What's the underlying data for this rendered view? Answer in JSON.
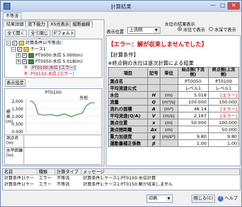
{
  "window": {
    "title": "計算結果"
  },
  "left": {
    "outer_tab": "不等流",
    "tabs": [
      "結果詳細",
      "流下能力",
      "XS光表示",
      "縦断曲線"
    ],
    "buttons": [
      "全て開く",
      "全て閉じる",
      "デフォルト"
    ],
    "tree": [
      {
        "label": "計算条件1(不等流)",
        "level": 0
      },
      {
        "label": "ケース1",
        "level": 1
      },
      {
        "label": "PT0000:水位 5.000(m)",
        "level": 2,
        "error": false
      },
      {
        "label": "PT0050:水位 5.018(m)",
        "level": 2,
        "error": false
      },
      {
        "label": "PT0100:水位 [エラー]",
        "level": 2,
        "error": true,
        "selected": true
      },
      {
        "label": "PT0150:水位 [エラー]",
        "level": 2,
        "error": true
      }
    ],
    "display_settings_button": "表示設定",
    "plot": {
      "title": "PT0100",
      "outside_label": "外形",
      "y_label": "標高(m)",
      "y_ticks": [
        "2,000",
        "1,500",
        "1,000",
        "0.500",
        "0.000"
      ],
      "rows": [
        {
          "label": "測点名",
          "sub": "(m)"
        },
        {
          "label": "水平距離",
          "sub": "(m)"
        }
      ]
    }
  },
  "right": {
    "display_position_label": "表示位置",
    "display_position_value": "上流側",
    "water_level_label": "水位の結果表示",
    "radio_options": [
      "水位で表示",
      "水深で表示"
    ],
    "radio_selected": 0,
    "error_message": "【エラー：解が収束しませんでした】",
    "section_title": "【計算条件】",
    "note": "※終点側の水位は逐次計算による結果",
    "table": {
      "headers": [
        "項目",
        "記号",
        "単位",
        "始点側(下流側)",
        "終点側(上流側)"
      ],
      "rows": [
        {
          "label": "測点名",
          "symbol": "",
          "unit": "",
          "start": "PT0050",
          "end": "PT0100",
          "align": "ctr"
        },
        {
          "label": "平均流速公式",
          "symbol": "",
          "unit": "",
          "start": "レベル1",
          "end": "レベル1",
          "align": "ctr"
        },
        {
          "label": "水位",
          "symbol": "H",
          "unit": "(m)",
          "start": "5.018",
          "end": "[エラー]",
          "align": "num"
        },
        {
          "label": "流量",
          "symbol": "Q",
          "unit": "(m³/s)",
          "start": "100.000",
          "end": "100.000",
          "align": "num"
        },
        {
          "label": "流れの面積",
          "symbol": "A",
          "unit": "(m²)",
          "start": "46.14",
          "end": "[エラー]",
          "align": "num"
        },
        {
          "label": "平均流速(Q/A)",
          "symbol": "V",
          "unit": "(m/s)",
          "start": "2.167",
          "end": "[エラー]",
          "align": "num"
        },
        {
          "label": "測点位置",
          "symbol": "x",
          "unit": "(m)",
          "start": "50.000",
          "end": "100.000",
          "align": "num"
        },
        {
          "label": "測点間距離",
          "symbol": "Δx",
          "unit": "(m)",
          "start": "",
          "end": "50.000",
          "align": "num"
        },
        {
          "label": "重力加速度",
          "symbol": "g",
          "unit": "(m/s²)",
          "start": "9.80",
          "end": "9.80",
          "align": "num"
        },
        {
          "label": "運動量補正係数",
          "symbol": "β",
          "unit": "",
          "start": "1.00",
          "end": "1.00",
          "align": "num"
        }
      ]
    }
  },
  "log": {
    "columns": [
      "名前",
      "種類",
      "計算タイプ",
      "メッセージ"
    ],
    "rows": [
      [
        "計算条件1(ケー",
        "エラー",
        "不等流",
        "計算条件1:ケース1:PT0100:水位計算"
      ],
      [
        "計算条件1(ケー",
        "エラー",
        "不等流",
        "計算条件1:ケース1:PT0150:解が収束しません"
      ]
    ]
  },
  "footer": {
    "print_label": "印刷",
    "close_label": "閉じる(C)",
    "help_label": "ヘルプ"
  },
  "colors": {
    "error": "#e00000",
    "plot_line": "#2e8b2e",
    "selected": "#cfe3f8"
  }
}
